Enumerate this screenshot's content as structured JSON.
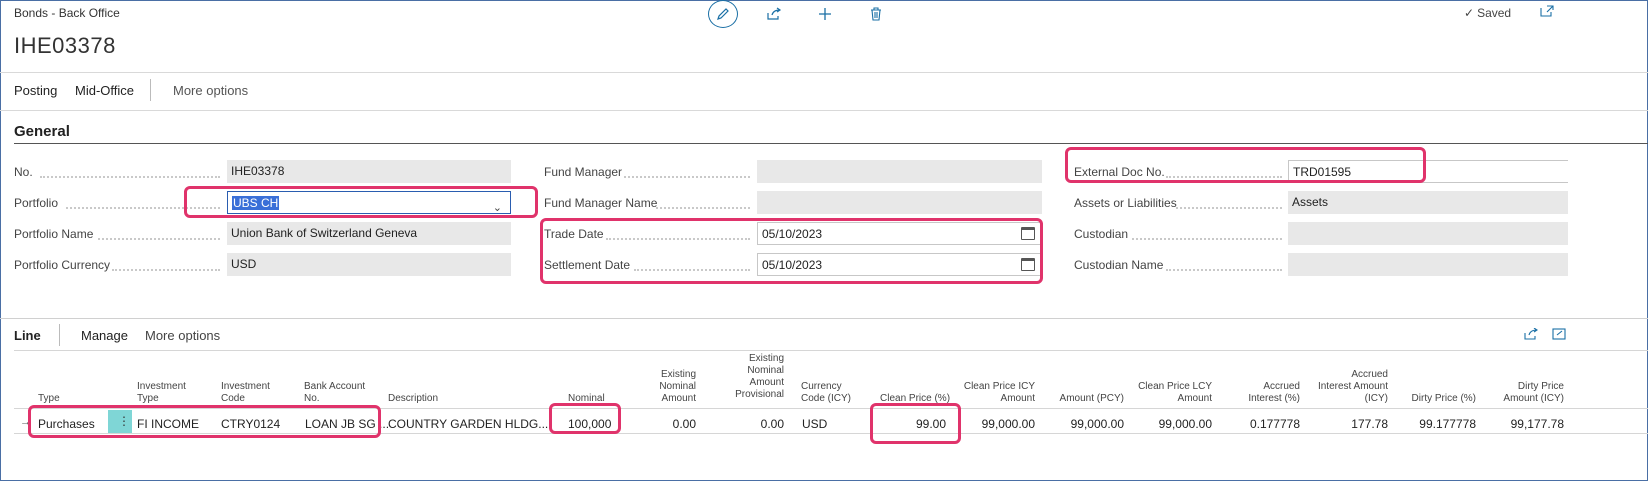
{
  "header": {
    "breadcrumb": "Bonds - Back Office",
    "title": "IHE03378",
    "saved_label": "Saved"
  },
  "toolbar": {
    "edit_icon": "pencil-icon",
    "share_icon": "share-icon",
    "add_icon": "plus-icon",
    "delete_icon": "trash-icon"
  },
  "actions": {
    "posting": "Posting",
    "mid_office": "Mid-Office",
    "more": "More options"
  },
  "general": {
    "title": "General",
    "no_label": "No.",
    "no_value": "IHE03378",
    "portfolio_label": "Portfolio",
    "portfolio_value": "UBS CH",
    "portfolio_name_label": "Portfolio Name",
    "portfolio_name_value": "Union Bank of Switzerland Geneva",
    "portfolio_currency_label": "Portfolio Currency",
    "portfolio_currency_value": "USD",
    "fund_manager_label": "Fund Manager",
    "fund_manager_value": "",
    "fund_manager_name_label": "Fund Manager Name",
    "fund_manager_name_value": "",
    "trade_date_label": "Trade Date",
    "trade_date_value": "05/10/2023",
    "settlement_date_label": "Settlement Date",
    "settlement_date_value": "05/10/2023",
    "external_doc_label": "External Doc No.",
    "external_doc_value": "TRD01595",
    "assets_label": "Assets or Liabilities",
    "assets_value": "Assets",
    "custodian_label": "Custodian",
    "custodian_value": "",
    "custodian_name_label": "Custodian Name",
    "custodian_name_value": ""
  },
  "lines": {
    "title": "Line",
    "manage": "Manage",
    "more": "More options",
    "columns": {
      "type": "Type",
      "investment_type_1": "Investment",
      "investment_type_2": "Type",
      "investment_code_1": "Investment",
      "investment_code_2": "Code",
      "bank_account_1": "Bank Account",
      "bank_account_2": "No.",
      "description": "Description",
      "nominal": "Nominal",
      "existing_nominal_1": "Existing",
      "existing_nominal_2": "Nominal",
      "existing_nominal_3": "Amount",
      "existing_prov_1": "Existing",
      "existing_prov_2": "Nominal",
      "existing_prov_3": "Amount",
      "existing_prov_4": "Provisional",
      "currency_code_1": "Currency",
      "currency_code_2": "Code (ICY)",
      "clean_price": "Clean Price (%)",
      "clean_price_icy_1": "Clean Price ICY",
      "clean_price_icy_2": "Amount",
      "amount_pcy": "Amount (PCY)",
      "clean_price_lcy_1": "Clean Price LCY",
      "clean_price_lcy_2": "Amount",
      "accrued_interest_1": "Accrued",
      "accrued_interest_2": "Interest (%)",
      "accrued_amount_1": "Accrued",
      "accrued_amount_2": "Interest Amount",
      "accrued_amount_3": "(ICY)",
      "dirty_price": "Dirty Price (%)",
      "dirty_amount_1": "Dirty Price",
      "dirty_amount_2": "Amount (ICY)"
    },
    "row": {
      "type": "Purchases",
      "investment_type": "FI INCOME",
      "investment_code": "CTRY0124",
      "bank_account": "LOAN JB SG ...",
      "description": "COUNTRY GARDEN HLDG...",
      "nominal": "100,000",
      "existing_nominal": "0.00",
      "existing_prov": "0.00",
      "currency": "USD",
      "clean_price": "99.00",
      "clean_price_icy": "99,000.00",
      "amount_pcy": "99,000.00",
      "clean_price_lcy": "99,000.00",
      "accrued_interest": "0.177778",
      "accrued_amount": "177.78",
      "dirty_price": "99.177778",
      "dirty_amount": "99,177.78"
    }
  },
  "colors": {
    "accent": "#1a6fa5",
    "highlight": "#e0336b",
    "field_bg": "#e8e8e8",
    "selection": "#3a6fd8",
    "cell_accent": "#7fd6d6"
  }
}
